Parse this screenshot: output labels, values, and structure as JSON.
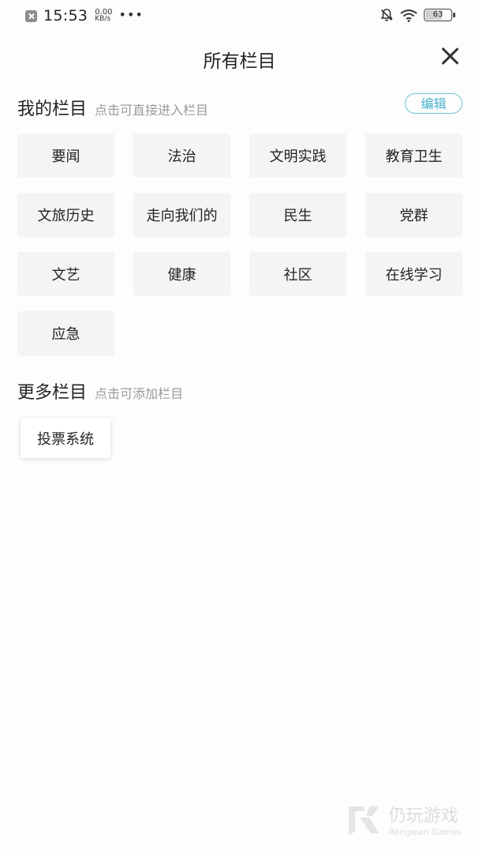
{
  "status_bar": {
    "time": "15:53",
    "net_speed_value": "0.00",
    "net_speed_unit": "KB/s",
    "more_dots": "•••",
    "battery": "63"
  },
  "header": {
    "title": "所有栏目"
  },
  "my_channels": {
    "title": "我的栏目",
    "hint": "点击可直接进入栏目",
    "edit_label": "编辑",
    "items": [
      "要闻",
      "法治",
      "文明实践",
      "教育卫生",
      "文旅历史",
      "走向我们的",
      "民生",
      "党群",
      "文艺",
      "健康",
      "社区",
      "在线学习",
      "应急"
    ]
  },
  "more_channels": {
    "title": "更多栏目",
    "hint": "点击可添加栏目",
    "items": [
      "投票系统"
    ]
  },
  "watermark": {
    "name_cn": "仍玩游戏",
    "name_en": "Rengwan Games"
  },
  "colors": {
    "accent": "#47b3cc",
    "chip_bg": "#f4f4f4",
    "hint": "#9a9a9a"
  },
  "icons": [
    "notification-blocked-icon",
    "bell-off-icon",
    "wifi-icon",
    "battery-icon",
    "close-icon"
  ]
}
